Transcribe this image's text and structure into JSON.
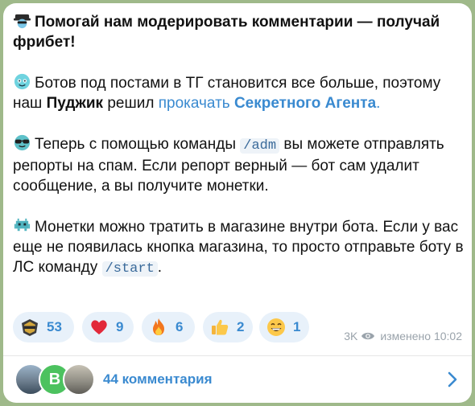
{
  "post": {
    "title": "Помогай нам модерировать комментарии — получай фрибет!",
    "p1_a": "Ботов под постами в ТГ становится все больше, поэтому наш ",
    "p1_bold": "Пуджик",
    "p1_b": " решил ",
    "p1_link": "прокачать",
    "p1_link_bold": "Секретного Агента",
    "p1_end": ".",
    "p2_a": "Теперь с помощью команды ",
    "p2_code": "/adm",
    "p2_b": " вы можете отправлять репорты на спам. Если репорт верный — бот сам удалит сообщение, а вы получите монетки.",
    "p3_a": "Монетки можно тратить в магазине внутри бота. Если у вас еще не появилась кнопка магазина, то просто отправьте боту в ЛС команду ",
    "p3_code": "/start",
    "p3_end": "."
  },
  "reactions": [
    {
      "icon": "major-logo-icon",
      "count": "53"
    },
    {
      "icon": "heart-icon",
      "count": "9"
    },
    {
      "icon": "fire-icon",
      "count": "6"
    },
    {
      "icon": "thumbs-up-icon",
      "count": "2"
    },
    {
      "icon": "grinning-face-icon",
      "count": "1"
    }
  ],
  "meta": {
    "views": "3K",
    "edited": "изменено 10:02"
  },
  "comments": {
    "label": "44 комментария",
    "avatar_letter": "В"
  },
  "colors": {
    "link": "#3a8ad0",
    "reaction_bg": "#e8f1fa",
    "background": "#9fb98a"
  }
}
